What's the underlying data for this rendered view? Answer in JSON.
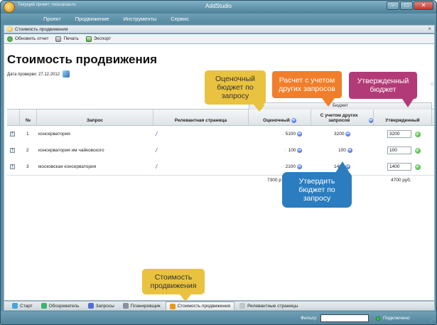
{
  "window": {
    "title": "AddStudio",
    "project_label": "Текущий проект: moscanav.ru",
    "min": "–",
    "max": "□",
    "close": "✕"
  },
  "menu": [
    "Проект",
    "Продвижение",
    "Инструменты",
    "Сервис"
  ],
  "doc_tab": {
    "label": "Стоимость продвижения",
    "close": "×"
  },
  "toolbar": {
    "refresh": "Обновить отчет",
    "print": "Печать",
    "export": "Экспорт"
  },
  "page": {
    "title": "Стоимость продвижения",
    "check_date": "Дата проверки: 27.12.2012"
  },
  "table": {
    "budget_group": "Бюджет",
    "headers": {
      "num": "№",
      "query": "Запрос",
      "page": "Релевантная страница",
      "estimated": "Оценочный",
      "with_others": "С учетом других запросов",
      "approved": "Утвержденный"
    },
    "rows": [
      {
        "num": "1",
        "query": "консерватория",
        "page": "/",
        "estimated": "5100",
        "with_others": "3200",
        "approved": "3200"
      },
      {
        "num": "2",
        "query": "консерватория им чайковского",
        "page": "/",
        "estimated": "100",
        "with_others": "100",
        "approved": "100"
      },
      {
        "num": "3",
        "query": "московская консерватория",
        "page": "/",
        "estimated": "2100",
        "with_others": "1400",
        "approved": "1400"
      }
    ],
    "totals": {
      "estimated": "7300 р",
      "approved": "4700 руб."
    }
  },
  "callouts": {
    "estimated": "Оценочный бюджет по запросу",
    "with_others": "Расчет с учетом других запросов",
    "approved": "Утвержденный бюджет",
    "approve_action": "Утвердить бюджет по запросу",
    "cost_tab": "Стоимость продвижения"
  },
  "bottom_tabs": [
    {
      "label": "Старт",
      "name": "start",
      "color": "#4aa3df"
    },
    {
      "label": "Обозреватель",
      "name": "browser",
      "color": "#3cb371"
    },
    {
      "label": "Запросы",
      "name": "queries",
      "color": "#4f6fd6"
    },
    {
      "label": "Планировщик",
      "name": "scheduler",
      "color": "#8a8fa0"
    },
    {
      "label": "Стоимость продвижения",
      "name": "cost",
      "color": "#e59a1f",
      "active": true
    },
    {
      "label": "Релевантные страницы",
      "name": "relevant-pages",
      "color": "#bfc6cc"
    }
  ],
  "status": {
    "filter_label": "Фильтр:",
    "filter_value": "",
    "connection": "Подключено"
  }
}
